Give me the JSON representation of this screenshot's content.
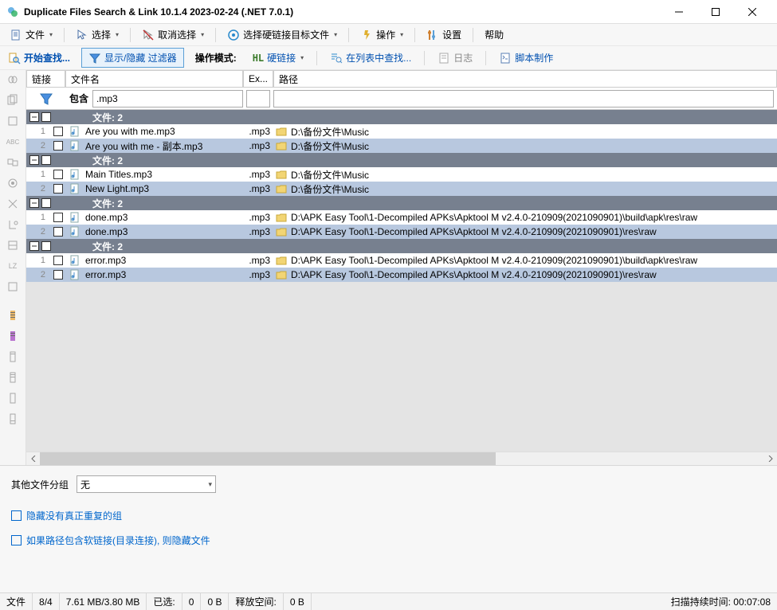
{
  "window": {
    "title": "Duplicate Files Search & Link 10.1.4 2023-02-24 (.NET 7.0.1)"
  },
  "menubar": {
    "file": "文件",
    "select": "选择",
    "unselect": "取消选择",
    "selectHardlink": "选择硬链接目标文件",
    "operate": "操作",
    "settings": "设置",
    "help": "帮助"
  },
  "toolbar2": {
    "startSearch": "开始查找...",
    "showHideFilter": "显示/隐藏 过滤器",
    "opMode": "操作模式:",
    "hardlink": "硬链接",
    "findInList": "在列表中查找...",
    "log": "日志",
    "scriptMake": "脚本制作"
  },
  "columns": {
    "link": "链接",
    "filename": "文件名",
    "ext": "Ex...",
    "path": "路径"
  },
  "filter": {
    "contains": "包含",
    "value": ".mp3"
  },
  "groups": [
    {
      "title": "文件: 2",
      "rows": [
        {
          "idx": "1",
          "name": "Are you with me.mp3",
          "ext": ".mp3",
          "path": "D:\\备份文件\\Music"
        },
        {
          "idx": "2",
          "name": "Are you with me - 副本.mp3",
          "ext": ".mp3",
          "path": "D:\\备份文件\\Music"
        }
      ]
    },
    {
      "title": "文件: 2",
      "rows": [
        {
          "idx": "1",
          "name": "Main Titles.mp3",
          "ext": ".mp3",
          "path": "D:\\备份文件\\Music"
        },
        {
          "idx": "2",
          "name": "New Light.mp3",
          "ext": ".mp3",
          "path": "D:\\备份文件\\Music"
        }
      ]
    },
    {
      "title": "文件: 2",
      "rows": [
        {
          "idx": "1",
          "name": "done.mp3",
          "ext": ".mp3",
          "path": "D:\\APK Easy Tool\\1-Decompiled APKs\\Apktool M v2.4.0-210909(2021090901)\\build\\apk\\res\\raw"
        },
        {
          "idx": "2",
          "name": "done.mp3",
          "ext": ".mp3",
          "path": "D:\\APK Easy Tool\\1-Decompiled APKs\\Apktool M v2.4.0-210909(2021090901)\\res\\raw"
        }
      ]
    },
    {
      "title": "文件: 2",
      "rows": [
        {
          "idx": "1",
          "name": "error.mp3",
          "ext": ".mp3",
          "path": "D:\\APK Easy Tool\\1-Decompiled APKs\\Apktool M v2.4.0-210909(2021090901)\\build\\apk\\res\\raw"
        },
        {
          "idx": "2",
          "name": "error.mp3",
          "ext": ".mp3",
          "path": "D:\\APK Easy Tool\\1-Decompiled APKs\\Apktool M v2.4.0-210909(2021090901)\\res\\raw"
        }
      ]
    }
  ],
  "bottom": {
    "otherGroup": "其他文件分组",
    "none": "无",
    "hideNoDup": "隐藏没有真正重复的组",
    "hideSoftlink": "如果路径包含软链接(目录连接), 则隐藏文件"
  },
  "status": {
    "files": "文件",
    "ratio": "8/4",
    "size": "7.61 MB/3.80 MB",
    "selected": "已选:",
    "selCount": "0",
    "selSize": "0 B",
    "freeSpace": "释放空间:",
    "freeSize": "0 B",
    "scanTime": "扫描持续时间:  00:07:08"
  }
}
